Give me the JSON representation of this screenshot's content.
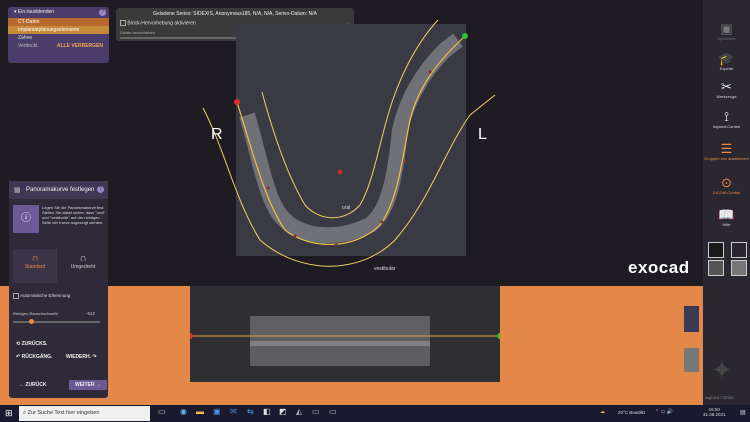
{
  "layers": {
    "header": "Ein-/ausblenden",
    "help": "?",
    "rows": [
      "CT-Daten",
      "Implantatplanungselemente"
    ],
    "group": "Zähne",
    "footer_left": "Verdeckt",
    "footer_right": "ALLE VERBERGEN"
  },
  "series": {
    "title": "Geladene Series: SIDEXIS, Anonymous185, N/A, N/A, Series-Datum: N/A",
    "checkbox_label": "Block-Hervorhebung aktivieren",
    "slider_label": "Dichte hervorheben",
    "slider_value": "2871"
  },
  "view": {
    "left_label": "R",
    "right_label": "L",
    "oral": "oral",
    "vestibular": "vestibulär"
  },
  "logo": "exocad",
  "toolbar": {
    "items": [
      {
        "label": "Speichern",
        "icon": "save-icon"
      },
      {
        "label": "Experte",
        "icon": "graduation-cap-icon"
      },
      {
        "label": "Werkzeuge",
        "icon": "tools-icon"
      },
      {
        "label": "Implant-Control",
        "icon": "implant-icon"
      },
      {
        "label": "Gruppen ein/ ausblenden",
        "icon": "layers-icon"
      },
      {
        "label": "DICOM-Control",
        "icon": "dicom-icon"
      },
      {
        "label": "Hilfe",
        "icon": "help-icon"
      }
    ],
    "version": "Impl v3.0 7737/64"
  },
  "panel": {
    "title": "Panoramakurve festlegen",
    "help": "?",
    "info": "Legen Sie die Panoramakurve fest. Stellen Sie dabei sicher, dass \"oral\" und \"vestibulär\" auf der richtigen Seite der Kurve angezeigt werden.",
    "standard": "Standard",
    "umgedreht": "Umgedreht",
    "auto_detect": "Automatische Erkennung",
    "slider_label": "Röntgen-Rauschschwelle",
    "slider_value": "-512",
    "zurueck_small": "ZURÜCKS.",
    "rueckgang": "RÜCKGÄNG.",
    "wiederh": "WIEDERH.",
    "zurueck": "ZURÜCK",
    "weiter": "WEITER"
  },
  "taskbar": {
    "search_placeholder": "Zur Suche Text hier eingeben",
    "weather": "20°C Bewölkt",
    "time": "16:50",
    "date": "31.08.2021"
  },
  "colors": {
    "accent": "#f08a40",
    "panel": "#4a3d6b",
    "band": "#e4884a"
  }
}
